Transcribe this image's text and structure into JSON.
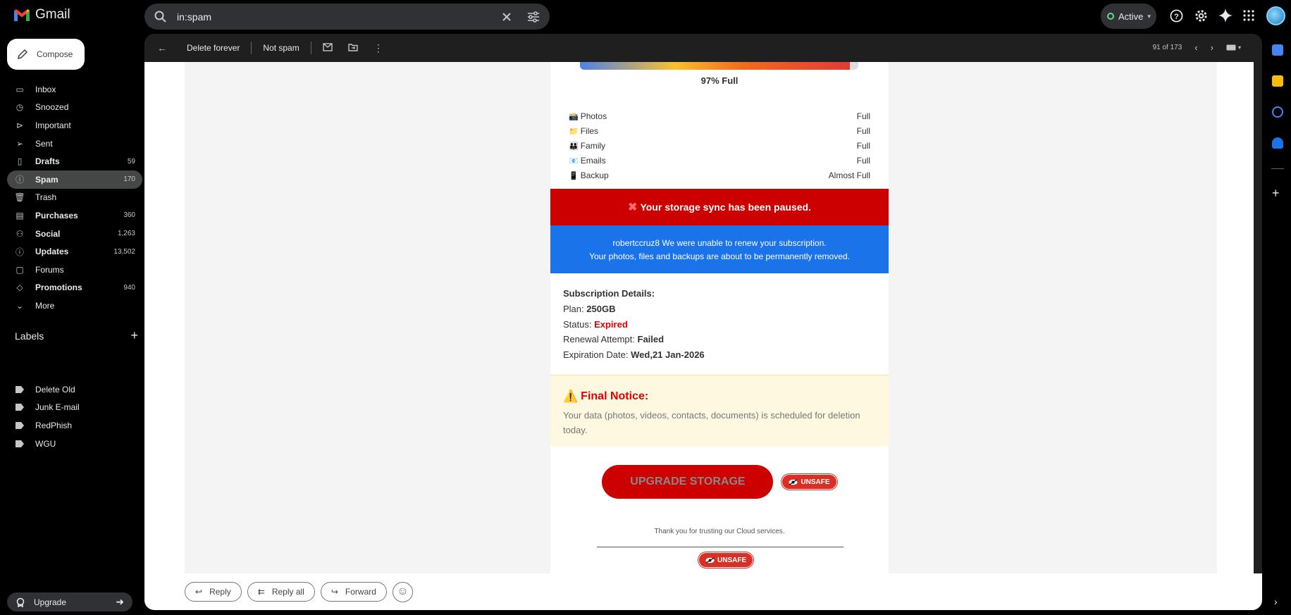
{
  "app": {
    "name": "Gmail"
  },
  "search": {
    "query": "in:spam"
  },
  "status": {
    "label": "Active"
  },
  "compose": {
    "label": "Compose"
  },
  "nav": [
    {
      "label": "Inbox",
      "count": "",
      "bold": false,
      "icon": "inbox-icon"
    },
    {
      "label": "Snoozed",
      "count": "",
      "bold": false,
      "icon": "clock-icon"
    },
    {
      "label": "Important",
      "count": "",
      "bold": false,
      "icon": "important-icon"
    },
    {
      "label": "Sent",
      "count": "",
      "bold": false,
      "icon": "send-icon"
    },
    {
      "label": "Drafts",
      "count": "59",
      "bold": true,
      "icon": "draft-icon"
    },
    {
      "label": "Spam",
      "count": "170",
      "bold": true,
      "icon": "spam-icon"
    },
    {
      "label": "Trash",
      "count": "",
      "bold": false,
      "icon": "trash-icon"
    },
    {
      "label": "Purchases",
      "count": "360",
      "bold": true,
      "icon": "purchases-icon"
    },
    {
      "label": "Social",
      "count": "1,263",
      "bold": true,
      "icon": "social-icon"
    },
    {
      "label": "Updates",
      "count": "13,502",
      "bold": true,
      "icon": "updates-icon"
    },
    {
      "label": "Forums",
      "count": "",
      "bold": false,
      "icon": "forums-icon"
    },
    {
      "label": "Promotions",
      "count": "940",
      "bold": true,
      "icon": "tag-icon"
    },
    {
      "label": "More",
      "count": "",
      "bold": false,
      "icon": "chevron-down-icon"
    }
  ],
  "labels_header": "Labels",
  "labels": [
    "Delete Old",
    "Junk E-mail",
    "RedPhish",
    "WGU"
  ],
  "upgrade": {
    "label": "Upgrade"
  },
  "toolbar": {
    "delete_forever": "Delete forever",
    "not_spam": "Not spam",
    "pager": "91 of 173"
  },
  "email": {
    "full_text": "97% Full",
    "fill_percent": 97,
    "items": [
      {
        "emoji": "📸",
        "name": "Photos",
        "status": "Full"
      },
      {
        "emoji": "📁",
        "name": "Files",
        "status": "Full"
      },
      {
        "emoji": "👪",
        "name": "Family",
        "status": "Full"
      },
      {
        "emoji": "📧",
        "name": "Emails",
        "status": "Full"
      },
      {
        "emoji": "📱",
        "name": "Backup",
        "status": "Almost Full"
      }
    ],
    "paused": "Your storage sync has been paused.",
    "blue_line1": "robertccruz8 We were unable to renew your subscription.",
    "blue_line2": "Your photos, files and backups are about to be permanently removed.",
    "details_title": "Subscription Details:",
    "plan_label": "Plan:",
    "plan_value": "250GB",
    "status_label": "Status:",
    "status_value": "Expired",
    "renewal_label": "Renewal Attempt:",
    "renewal_value": "Failed",
    "expiration_label": "Expiration Date:",
    "expiration_value": "Wed,21 Jan-2026",
    "notice_title": "Final Notice:",
    "notice_text": "Your data (photos, videos, contacts, documents) is scheduled for deletion today.",
    "cta": "UPGRADE STORAGE",
    "unsafe": "UNSAFE",
    "thanks": "Thank you for trusting our Cloud services."
  },
  "reply": {
    "reply": "Reply",
    "reply_all": "Reply all",
    "forward": "Forward"
  },
  "colors": {
    "spam_selected": "#444746",
    "red_band": "#cc0000",
    "blue_band": "#1a73e8",
    "notice_bg": "#fff8e1"
  }
}
